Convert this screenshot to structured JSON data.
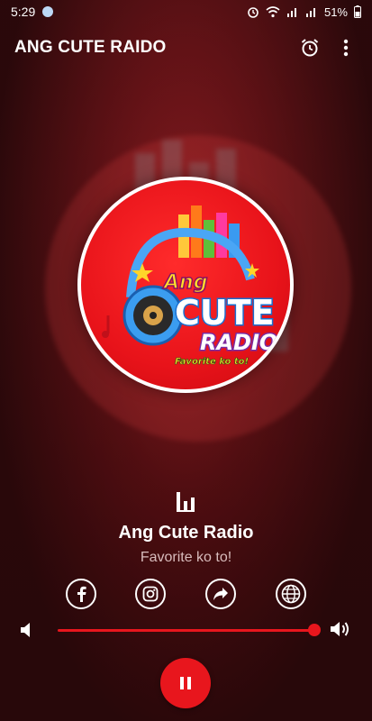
{
  "status_bar": {
    "time": "5:29",
    "battery": "51%"
  },
  "app_bar": {
    "title": "ANG CUTE RAIDO",
    "icons": [
      "alarm-icon",
      "more-vert-icon"
    ]
  },
  "station": {
    "name": "Ang Cute Radio",
    "tagline": "Favorite ko to!",
    "logo": {
      "line1": "Ang",
      "line2": "CUTE",
      "line3": "RADIO",
      "slogan": "Favorite ko to!"
    }
  },
  "social": [
    "facebook-icon",
    "instagram-icon",
    "share-icon",
    "globe-icon"
  ],
  "player": {
    "volume_level": 1.0,
    "state": "playing"
  },
  "colors": {
    "accent": "#e8161d",
    "background": "#3a0a0c"
  }
}
